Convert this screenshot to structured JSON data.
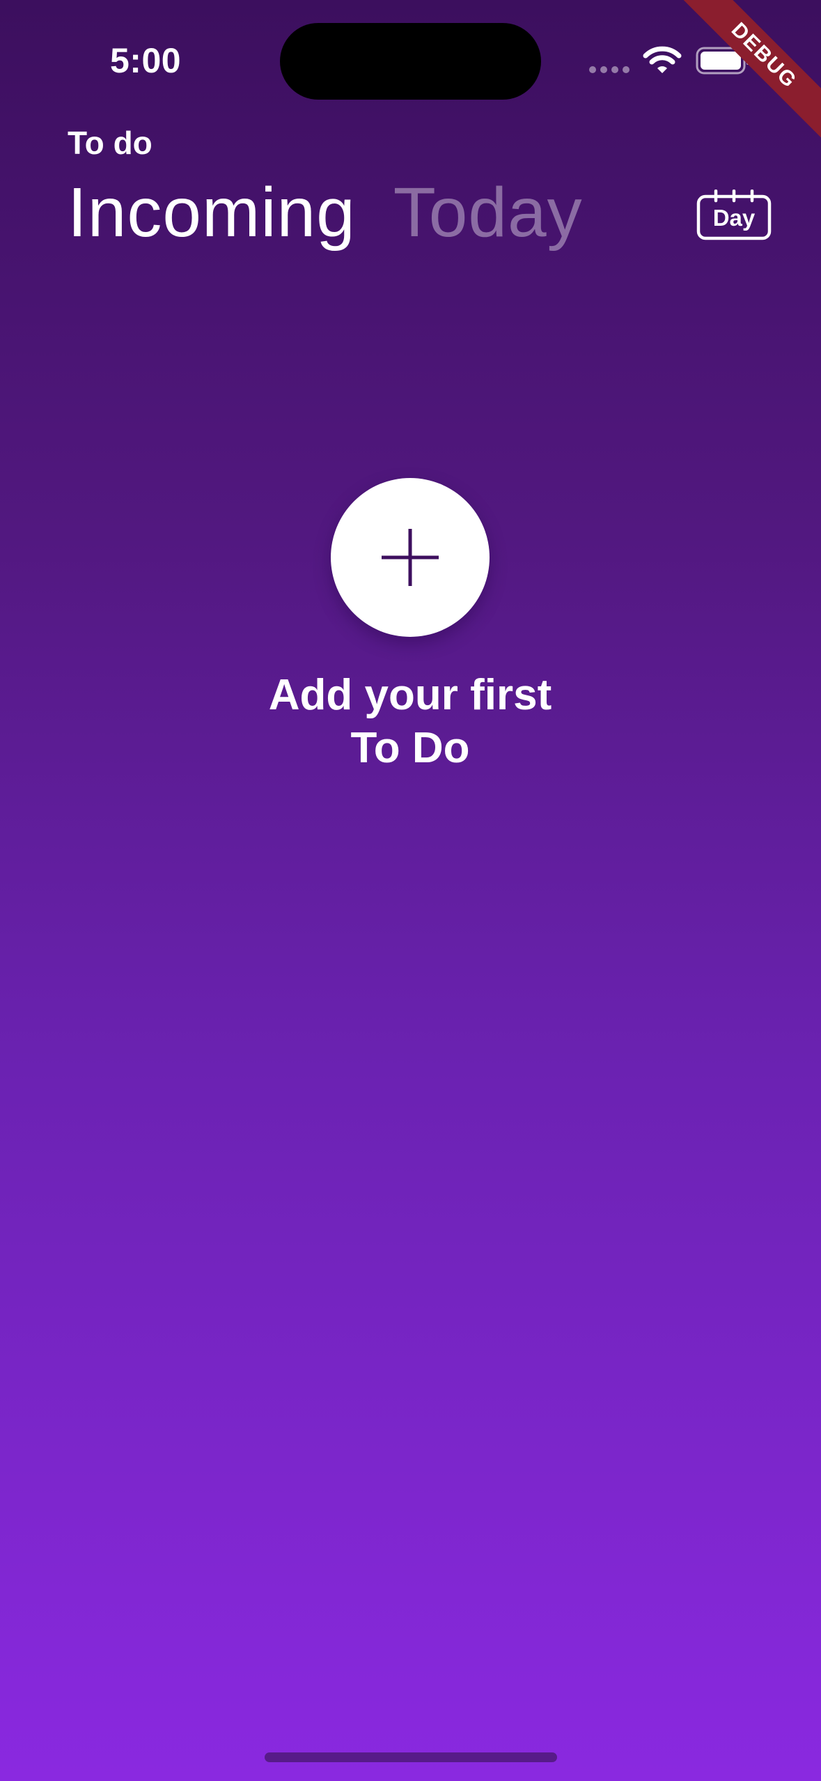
{
  "status_bar": {
    "time": "5:00",
    "icons": [
      "signal-dots-icon",
      "wifi-icon",
      "battery-icon"
    ]
  },
  "debug_banner": "DEBUG",
  "header": {
    "app_label": "To do",
    "tabs": [
      {
        "label": "Incoming",
        "active": true
      },
      {
        "label": "Today",
        "active": false
      }
    ],
    "calendar_button": {
      "label": "Day",
      "icon": "calendar-icon"
    }
  },
  "empty_state": {
    "add_icon": "plus-icon",
    "message_line1": "Add your first",
    "message_line2": "To Do"
  },
  "colors": {
    "gradient_top": "#3c0f5e",
    "gradient_bottom": "#8a29e0",
    "plus_stroke": "#3d0f5e",
    "debug_banner": "#8b1e2e"
  }
}
